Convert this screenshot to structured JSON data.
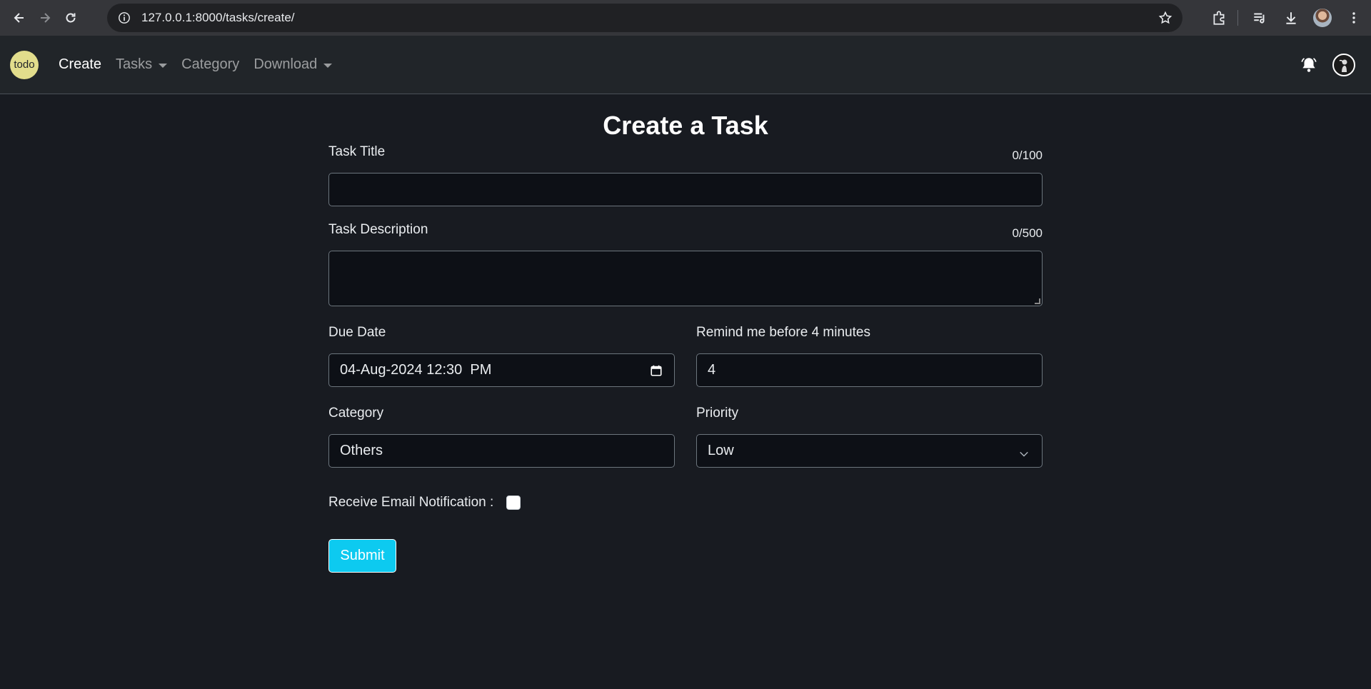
{
  "browser": {
    "url": "127.0.0.1:8000/tasks/create/"
  },
  "navbar": {
    "logo_text": "todo",
    "links": [
      {
        "label": "Create",
        "active": true
      },
      {
        "label": "Tasks",
        "dropdown": true
      },
      {
        "label": "Category"
      },
      {
        "label": "Download",
        "dropdown": true
      }
    ]
  },
  "form": {
    "title": "Create a Task",
    "task_title": {
      "label": "Task Title",
      "counter": "0/100",
      "value": ""
    },
    "task_description": {
      "label": "Task Description",
      "counter": "0/500",
      "value": ""
    },
    "due_date": {
      "label": "Due Date",
      "value": "04-Aug-2024 12:30  PM"
    },
    "remind": {
      "label": "Remind me before 4 minutes",
      "value": "4"
    },
    "category": {
      "label": "Category",
      "value": "Others"
    },
    "priority": {
      "label": "Priority",
      "value": "Low"
    },
    "email_notification": {
      "label": "Receive Email Notification :",
      "checked": false
    },
    "submit_label": "Submit"
  },
  "colors": {
    "background": "#181b21",
    "navbar": "#212529",
    "submit": "#0dcaf0",
    "logo": "#e2dd8c"
  }
}
